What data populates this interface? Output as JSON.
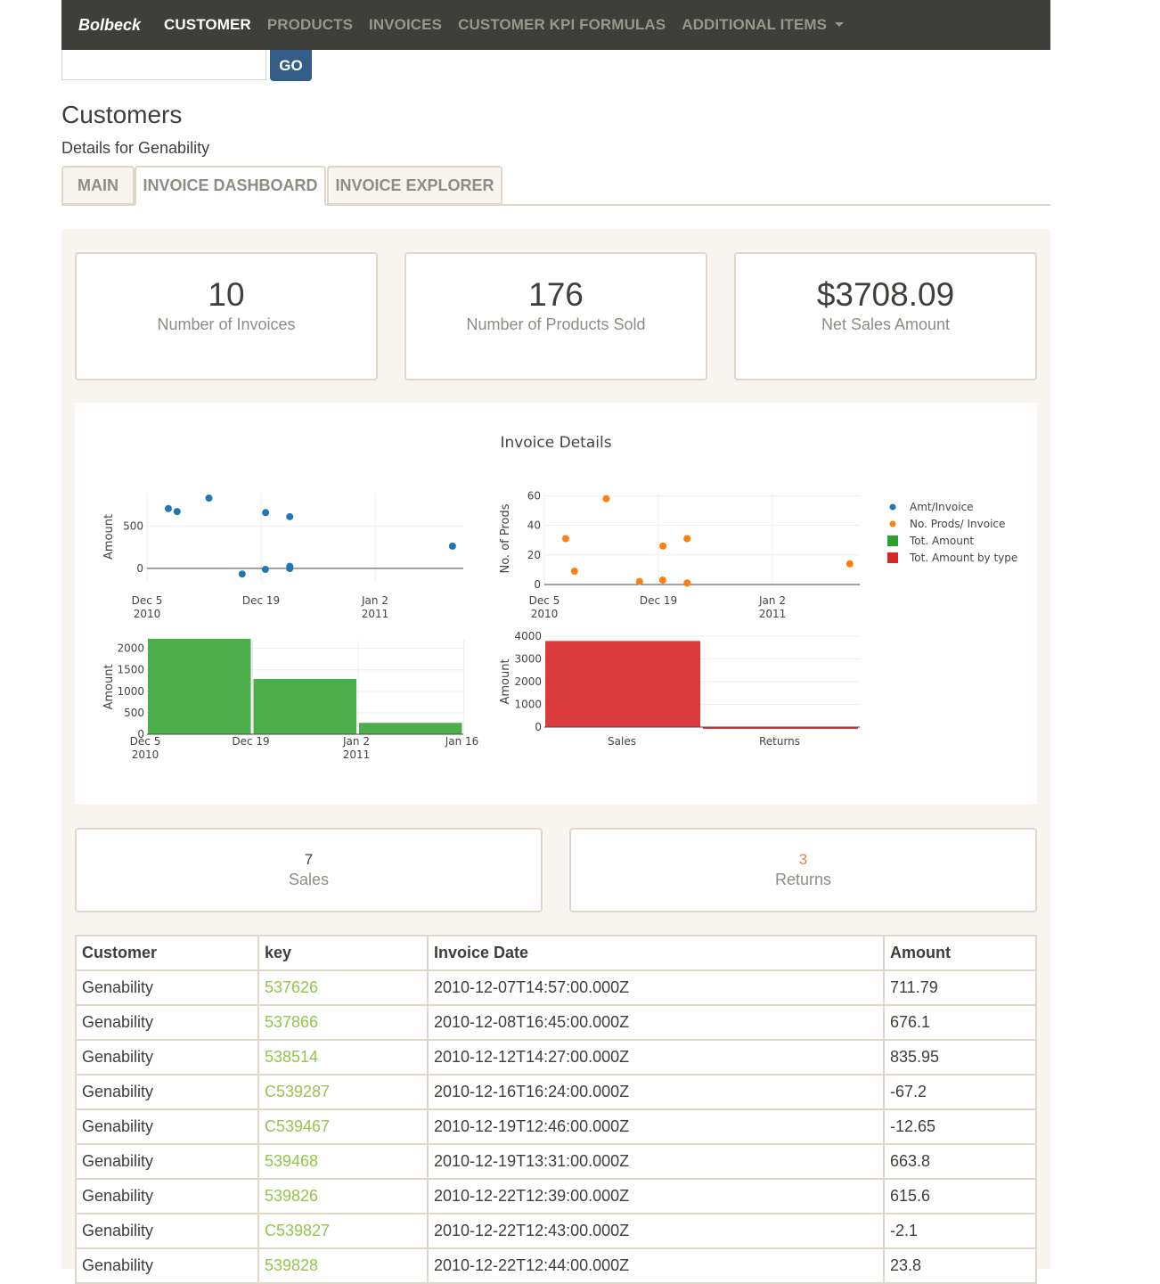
{
  "nav": {
    "brand": "Bolbeck",
    "items": [
      {
        "label": "CUSTOMER",
        "active": true
      },
      {
        "label": "PRODUCTS",
        "active": false
      },
      {
        "label": "INVOICES",
        "active": false
      },
      {
        "label": "CUSTOMER KPI FORMULAS",
        "active": false
      },
      {
        "label": "ADDITIONAL ITEMS",
        "active": false,
        "dropdown": true
      }
    ]
  },
  "search": {
    "value": "",
    "go_label": "GO"
  },
  "page": {
    "title": "Customers",
    "subtitle": "Details for Genability"
  },
  "tabs": [
    {
      "label": "MAIN",
      "active": false
    },
    {
      "label": "INVOICE DASHBOARD",
      "active": true
    },
    {
      "label": "INVOICE EXPLORER",
      "active": false
    }
  ],
  "kpis": [
    {
      "value": "10",
      "label": "Number of Invoices"
    },
    {
      "value": "176",
      "label": "Number of Products Sold"
    },
    {
      "value": "$3708.09",
      "label": "Net Sales Amount"
    }
  ],
  "colors": {
    "nav_bg": "#3e3f3a",
    "primary": "#325d88",
    "link": "#93c54b",
    "warning": "#f47c3c",
    "blue": "#1f77b4",
    "orange": "#ff7f0e",
    "green": "#2ca02c",
    "red": "#d62728"
  },
  "chart_data": {
    "title": "Invoice Details",
    "legend": {
      "placement": "top-right",
      "entries": [
        {
          "name": "Amt/Invoice",
          "symbol": "dot",
          "color": "#1f77b4"
        },
        {
          "name": "No. Prods/ Invoice",
          "symbol": "dot",
          "color": "#ff7f0e"
        },
        {
          "name": "Tot. Amount",
          "symbol": "square",
          "color": "#2ca02c"
        },
        {
          "name": "Tot. Amount by type",
          "symbol": "square",
          "color": "#d62728"
        }
      ]
    },
    "subplots": [
      {
        "type": "scatter",
        "series_name": "Amt/Invoice",
        "ylabel": "Amount",
        "xlabel": "",
        "x_ticks": [
          "Dec 5\n2010",
          "Dec 19",
          "Jan 2\n2011"
        ],
        "y_ticks": [
          "0",
          "500"
        ],
        "ylim": [
          -150,
          900
        ],
        "points": [
          {
            "x": "2010-12-07T14:57",
            "y": 711.79
          },
          {
            "x": "2010-12-08T16:45",
            "y": 676.1
          },
          {
            "x": "2010-12-12T14:27",
            "y": 835.95
          },
          {
            "x": "2010-12-16T16:24",
            "y": -67.2
          },
          {
            "x": "2010-12-19T12:46",
            "y": -12.65
          },
          {
            "x": "2010-12-19T13:31",
            "y": 663.8
          },
          {
            "x": "2010-12-22T12:39",
            "y": 615.6
          },
          {
            "x": "2010-12-22T12:43",
            "y": -2.1
          },
          {
            "x": "2010-12-22T12:44",
            "y": 23.8
          },
          {
            "x": "2011-01-11T12:00",
            "y": 265
          }
        ]
      },
      {
        "type": "scatter",
        "series_name": "No. Prods/ Invoice",
        "ylabel": "No. of Prods",
        "xlabel": "",
        "x_ticks": [
          "Dec 5\n2010",
          "Dec 19",
          "Jan 2\n2011"
        ],
        "y_ticks": [
          "0",
          "20",
          "40",
          "60"
        ],
        "ylim": [
          0,
          62
        ],
        "points": [
          {
            "x": "2010-12-07T14:57",
            "y": 31
          },
          {
            "x": "2010-12-08T16:45",
            "y": 9
          },
          {
            "x": "2010-12-12T14:27",
            "y": 58
          },
          {
            "x": "2010-12-16T16:24",
            "y": 2
          },
          {
            "x": "2010-12-19T12:46",
            "y": 3
          },
          {
            "x": "2010-12-19T13:31",
            "y": 26
          },
          {
            "x": "2010-12-22T12:39",
            "y": 31
          },
          {
            "x": "2010-12-22T12:43",
            "y": 1
          },
          {
            "x": "2010-12-22T12:44",
            "y": 1
          },
          {
            "x": "2011-01-11T12:00",
            "y": 14
          }
        ]
      },
      {
        "type": "bar",
        "series_name": "Tot. Amount",
        "ylabel": "Amount",
        "xlabel": "",
        "x_ticks": [
          "Dec 5\n2010",
          "Dec 19",
          "Jan 2\n2011",
          "Jan 16"
        ],
        "y_ticks": [
          "0",
          "500",
          "1000",
          "1500",
          "2000"
        ],
        "ylim": [
          0,
          2200
        ],
        "bars": [
          {
            "week": "Dec 5 2010",
            "value": 2224
          },
          {
            "week": "Dec 19 2010",
            "value": 1288
          },
          {
            "week": "Jan 2 2011",
            "value": 265
          }
        ]
      },
      {
        "type": "bar",
        "series_name": "Tot. Amount by type",
        "ylabel": "Amount",
        "xlabel": "",
        "categories": [
          "Sales",
          "Returns"
        ],
        "y_ticks": [
          "0",
          "1000",
          "2000",
          "3000",
          "4000"
        ],
        "ylim": [
          0,
          4000
        ],
        "values": [
          3790,
          -82
        ]
      }
    ]
  },
  "counts": {
    "sales": {
      "value": "7",
      "label": "Sales"
    },
    "returns": {
      "value": "3",
      "label": "Returns"
    }
  },
  "table": {
    "headers": [
      "Customer",
      "key",
      "Invoice Date",
      "Amount"
    ],
    "rows": [
      [
        "Genability",
        "537626",
        "2010-12-07T14:57:00.000Z",
        "711.79"
      ],
      [
        "Genability",
        "537866",
        "2010-12-08T16:45:00.000Z",
        "676.1"
      ],
      [
        "Genability",
        "538514",
        "2010-12-12T14:27:00.000Z",
        "835.95"
      ],
      [
        "Genability",
        "C539287",
        "2010-12-16T16:24:00.000Z",
        "-67.2"
      ],
      [
        "Genability",
        "C539467",
        "2010-12-19T12:46:00.000Z",
        "-12.65"
      ],
      [
        "Genability",
        "539468",
        "2010-12-19T13:31:00.000Z",
        "663.8"
      ],
      [
        "Genability",
        "539826",
        "2010-12-22T12:39:00.000Z",
        "615.6"
      ],
      [
        "Genability",
        "C539827",
        "2010-12-22T12:43:00.000Z",
        "-2.1"
      ],
      [
        "Genability",
        "539828",
        "2010-12-22T12:44:00.000Z",
        "23.8"
      ]
    ]
  }
}
